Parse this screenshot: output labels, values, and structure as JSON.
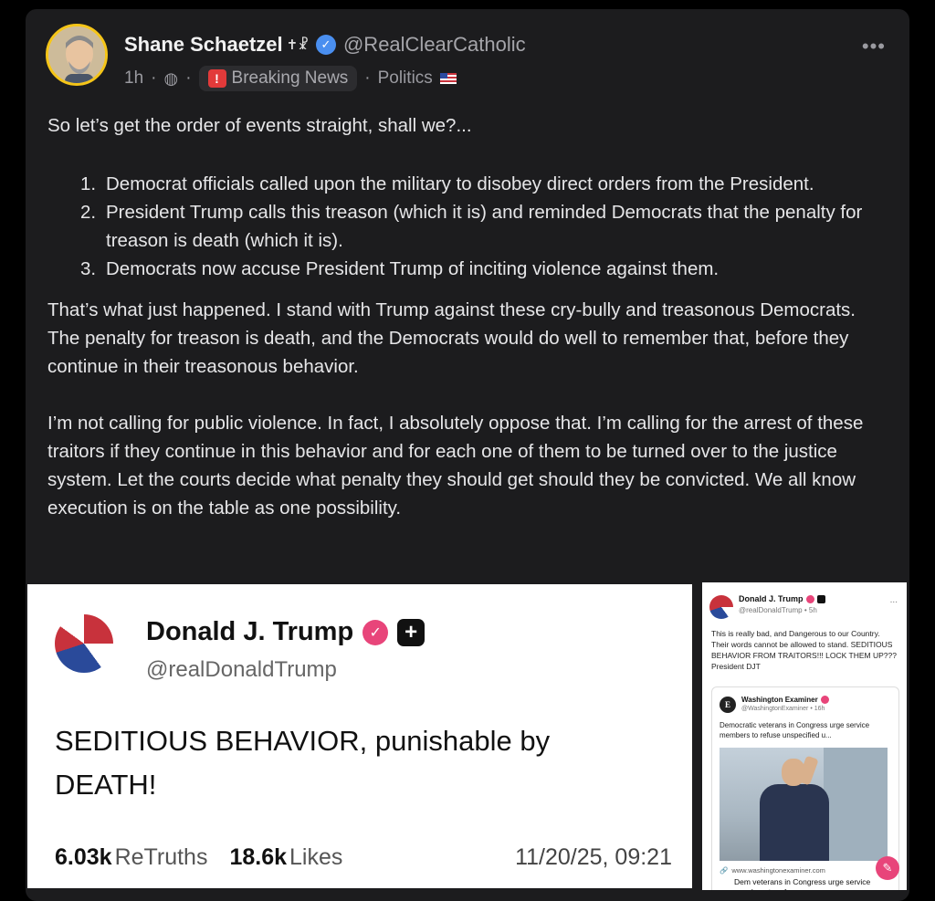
{
  "post": {
    "author_name": "Shane Schaetzel",
    "author_symbols": "✝☧",
    "author_handle": "@RealClearCatholic",
    "time": "1h",
    "dot": "·",
    "group_label": "Breaking News",
    "category": "Politics",
    "more_icon": "•••",
    "intro": "So let’s get the order of events straight, shall we?...",
    "list": [
      {
        "num": "1.",
        "text": "Democrat officials called upon the military to disobey direct orders from the President."
      },
      {
        "num": "2.",
        "text": "President Trump calls this treason (which it is) and reminded Democrats that the penalty for treason is death (which it is)."
      },
      {
        "num": "3.",
        "text": "Democrats now accuse President Trump of inciting violence against them."
      }
    ],
    "paragraph2": "That’s what just happened. I stand with Trump against these cry-bully and treasonous Democrats. The penalty for treason is death, and the Democrats would do well to remember that, before they continue in their treasonous behavior.",
    "paragraph3": "I’m not calling for public violence. In fact, I absolutely oppose that. I’m calling for the arrest of these traitors if they continue in this behavior and for each one of them to be turned over to the justice system. Let the courts decide what penalty they should get should they be convicted. We all know execution is on the table as one possibility."
  },
  "embed_left": {
    "name": "Donald J. Trump",
    "handle": "@realDonaldTrump",
    "text": "SEDITIOUS BEHAVIOR, punishable by DEATH!",
    "retruths_count": "6.03k",
    "retruths_label": "ReTruths",
    "likes_count": "18.6k",
    "likes_label": "Likes",
    "datetime": "11/20/25, 09:21"
  },
  "embed_right": {
    "name": "Donald J. Trump",
    "handle": "@realDonaldTrump • 5h",
    "more": "...",
    "text": "This is really bad, and Dangerous to our Country. Their words cannot be allowed to stand. SEDITIOUS BEHAVIOR FROM TRAITORS!!! LOCK THEM UP??? President DJT",
    "quote": {
      "name": "Washington Examiner",
      "handle": "@WashingtonExaminer • 16h",
      "text": "Democratic veterans in Congress urge service members to refuse unspecified u...",
      "link_url": "www.washingtonexaminer.com",
      "link_title": "Dem veterans in Congress urge service members to refuse"
    }
  },
  "colors": {
    "card_bg": "#1c1c1e",
    "avatar_ring": "#f5c518",
    "verified_blue": "#4a8ff0",
    "truth_pink": "#e8457a",
    "breaking_red": "#e23a3a"
  }
}
